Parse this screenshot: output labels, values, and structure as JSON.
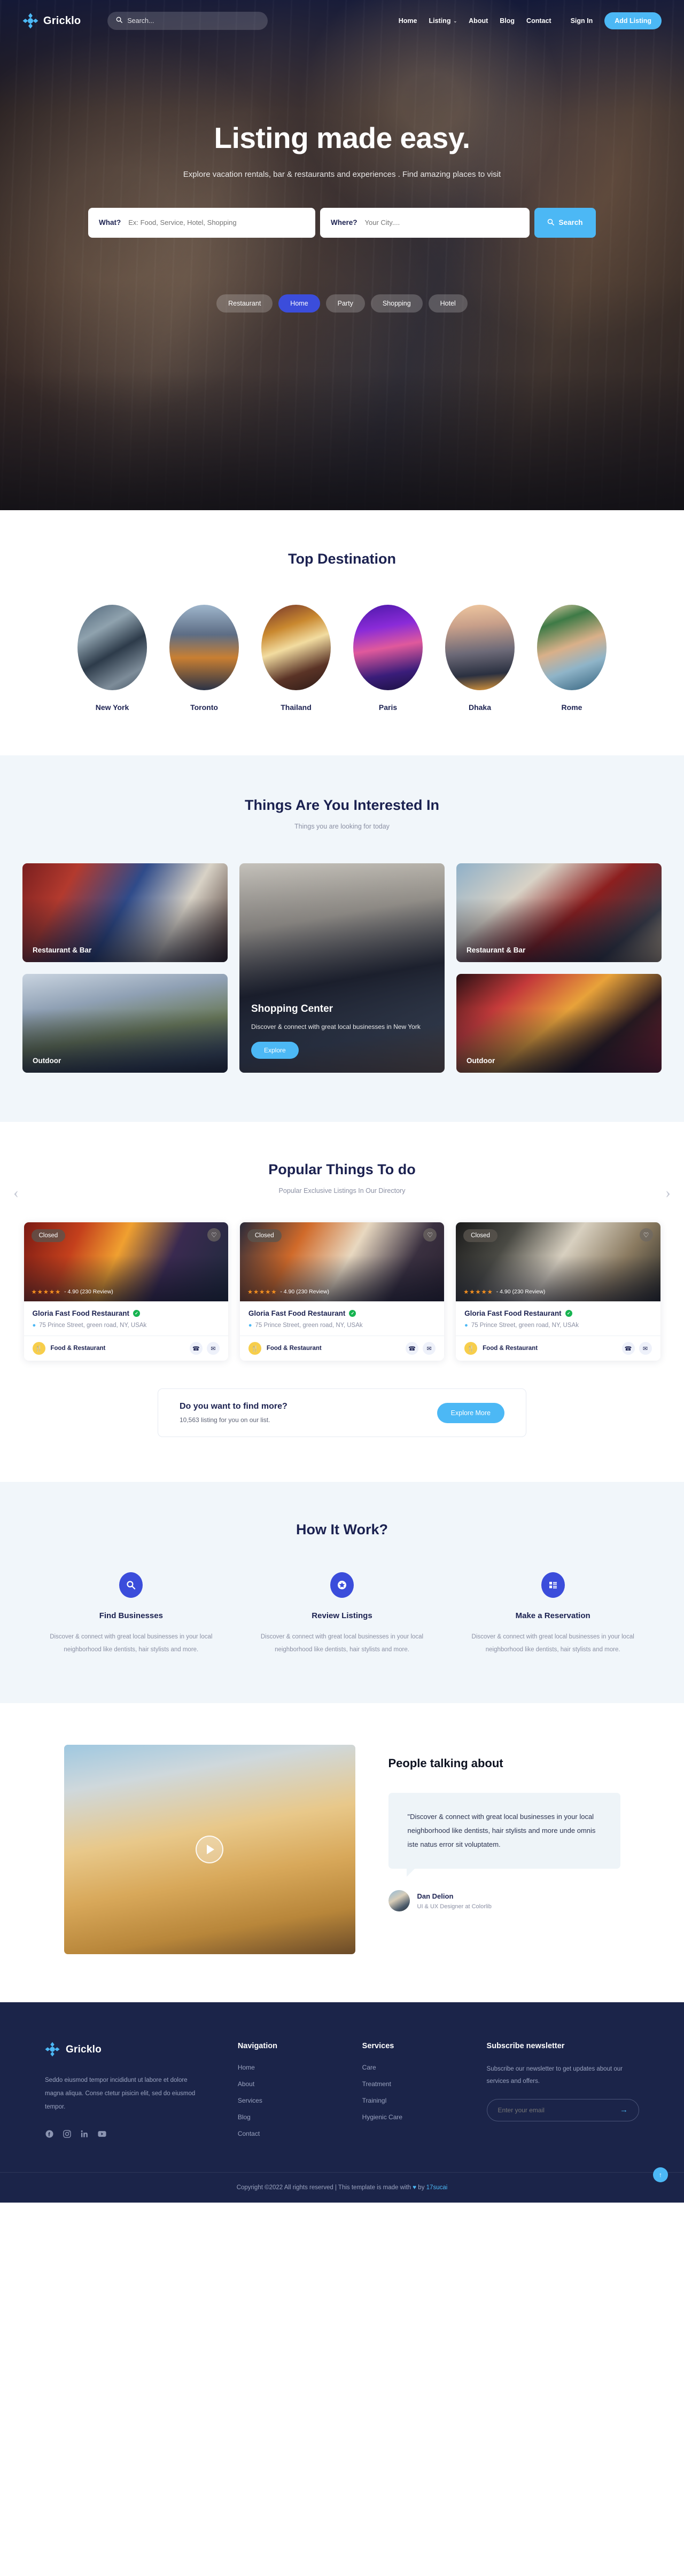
{
  "brand": {
    "name": "Gricklo",
    "accent": "#4cb8f5",
    "dark": "#1b2449"
  },
  "navbar": {
    "search_placeholder": "Search...",
    "links": [
      {
        "label": "Home"
      },
      {
        "label": "Listing",
        "caret": "⌄"
      },
      {
        "label": "About"
      },
      {
        "label": "Blog"
      },
      {
        "label": "Contact"
      }
    ],
    "signin": "Sign In",
    "add_listing": "Add Listing"
  },
  "hero": {
    "title": "Listing made easy.",
    "subtitle": "Explore vacation rentals, bar & restaurants and experiences . Find amazing places to visit",
    "search": {
      "what_label": "What?",
      "what_placeholder": "Ex: Food, Service, Hotel, Shopping",
      "where_label": "Where?",
      "where_placeholder": "Your City....",
      "button": "Search"
    },
    "pills": [
      {
        "label": "Restaurant",
        "active": false
      },
      {
        "label": "Home",
        "active": true
      },
      {
        "label": "Party",
        "active": false
      },
      {
        "label": "Shopping",
        "active": false
      },
      {
        "label": "Hotel",
        "active": false
      }
    ]
  },
  "destinations": {
    "title": "Top Destination",
    "items": [
      {
        "label": "New York"
      },
      {
        "label": "Toronto"
      },
      {
        "label": "Thailand"
      },
      {
        "label": "Paris"
      },
      {
        "label": "Dhaka"
      },
      {
        "label": "Rome"
      }
    ]
  },
  "interests": {
    "title": "Things Are You Interested In",
    "subtitle": "Things you are looking for today",
    "cards": [
      {
        "label": "Restaurant & Bar"
      },
      {
        "label": "Outdoor"
      },
      {
        "label": "Restaurant & Bar"
      },
      {
        "label": "Outdoor"
      }
    ],
    "featured": {
      "title": "Shopping Center",
      "desc": "Discover & connect with great local businesses in New York",
      "button": "Explore"
    }
  },
  "popular": {
    "title": "Popular Things To do",
    "subtitle": "Popular Exclusive Listings In Our Directory",
    "prev": "‹",
    "next": "›",
    "listings": [
      {
        "status": "Closed",
        "stars": "★★★★★",
        "rating": "- 4.90 (230 Review)",
        "name": "Gloria Fast Food Restaurant",
        "address": "75 Prince Street, green road, NY, USAk",
        "category": "Food & Restaurant"
      },
      {
        "status": "Closed",
        "stars": "★★★★★",
        "rating": "- 4.90 (230 Review)",
        "name": "Gloria Fast Food Restaurant",
        "address": "75 Prince Street, green road, NY, USAk",
        "category": "Food & Restaurant"
      },
      {
        "status": "Closed",
        "stars": "★★★★★",
        "rating": "- 4.90 (230 Review)",
        "name": "Gloria Fast Food Restaurant",
        "address": "75 Prince Street, green road, NY, USAk",
        "category": "Food & Restaurant"
      }
    ],
    "find_more": {
      "title": "Do you want to find more?",
      "subtitle": "10,563 listing for you on our list.",
      "button": "Explore More"
    }
  },
  "how_it_works": {
    "title": "How It Work?",
    "steps": [
      {
        "icon": "search-icon",
        "title": "Find Businesses",
        "desc": "Discover & connect with great local businesses in your local neighborhood like dentists, hair stylists and more."
      },
      {
        "icon": "star-badge-icon",
        "title": "Review Listings",
        "desc": "Discover & connect with great local businesses in your local neighborhood like dentists, hair stylists and more."
      },
      {
        "icon": "list-icon",
        "title": "Make a Reservation",
        "desc": "Discover & connect with great local businesses in your local neighborhood like dentists, hair stylists and more."
      }
    ]
  },
  "testimonial": {
    "heading": "People talking about",
    "quote": "\"Discover & connect with great local businesses in your local neighborhood like dentists, hair stylists and more unde omnis iste natus error sit voluptatem.",
    "author_name": "Dan Delion",
    "author_role": "UI & UX Designer at Colorlib"
  },
  "footer": {
    "about": "Seddo eiusmod tempor incididunt ut labore et dolore magna aliqua. Conse ctetur pisicin elit, sed do eiusmod tempor.",
    "socials": [
      {
        "name": "facebook-icon",
        "glyph": "f"
      },
      {
        "name": "instagram-icon",
        "glyph": "▢"
      },
      {
        "name": "linkedin-icon",
        "glyph": "in"
      },
      {
        "name": "youtube-icon",
        "glyph": "▶"
      }
    ],
    "navigation": {
      "title": "Navigation",
      "items": [
        {
          "label": "Home"
        },
        {
          "label": "About"
        },
        {
          "label": "Services"
        },
        {
          "label": "Blog"
        },
        {
          "label": "Contact"
        }
      ]
    },
    "services": {
      "title": "Services",
      "items": [
        {
          "label": "Care"
        },
        {
          "label": "Treatment"
        },
        {
          "label": "Trainingl"
        },
        {
          "label": "Hygienic Care"
        }
      ]
    },
    "newsletter": {
      "title": "Subscribe newsletter",
      "desc": "Subscribe our newsletter to get updates about our services and offers.",
      "placeholder": "Enter your email",
      "send": "→"
    },
    "copyright_pre": "Copyright ©2022 All rights reserved | This template is made with ",
    "copyright_heart": "♥",
    "copyright_mid": " by ",
    "copyright_brand": "17sucai",
    "to_top": "↑"
  }
}
